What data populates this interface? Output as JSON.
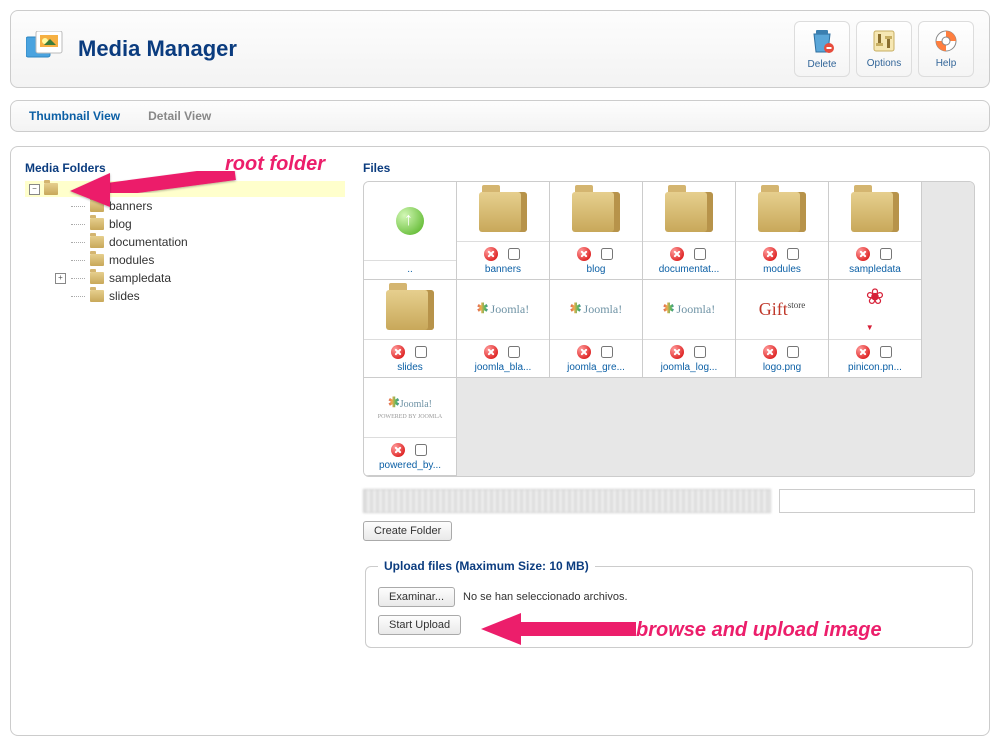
{
  "header": {
    "title": "Media Manager",
    "toolbar": [
      {
        "key": "delete",
        "label": "Delete"
      },
      {
        "key": "options",
        "label": "Options"
      },
      {
        "key": "help",
        "label": "Help"
      }
    ]
  },
  "tabs": {
    "thumbnail": "Thumbnail View",
    "detail": "Detail View",
    "active": "thumbnail"
  },
  "sidebar": {
    "title": "Media Folders",
    "folders": [
      "banners",
      "blog",
      "documentation",
      "modules",
      "sampledata",
      "slides"
    ]
  },
  "files": {
    "title": "Files",
    "items": [
      {
        "name": "..",
        "type": "up"
      },
      {
        "name": "banners",
        "type": "folder"
      },
      {
        "name": "blog",
        "type": "folder"
      },
      {
        "name": "documentat...",
        "type": "folder"
      },
      {
        "name": "modules",
        "type": "folder"
      },
      {
        "name": "sampledata",
        "type": "folder"
      },
      {
        "name": "slides",
        "type": "folder"
      },
      {
        "name": "joomla_bla...",
        "type": "joomla"
      },
      {
        "name": "joomla_gre...",
        "type": "joomla"
      },
      {
        "name": "joomla_log...",
        "type": "joomla"
      },
      {
        "name": "logo.png",
        "type": "gift"
      },
      {
        "name": "pinicon.pn...",
        "type": "pin"
      },
      {
        "name": "powered_by...",
        "type": "joomla-pw"
      }
    ]
  },
  "create_folder_btn": "Create Folder",
  "upload": {
    "legend": "Upload files (Maximum Size: 10 MB)",
    "browse_btn": "Examinar...",
    "no_file_text": "No se han seleccionado archivos.",
    "start_btn": "Start Upload"
  },
  "annotations": {
    "root": "root folder",
    "upload": "browse and upload image"
  }
}
